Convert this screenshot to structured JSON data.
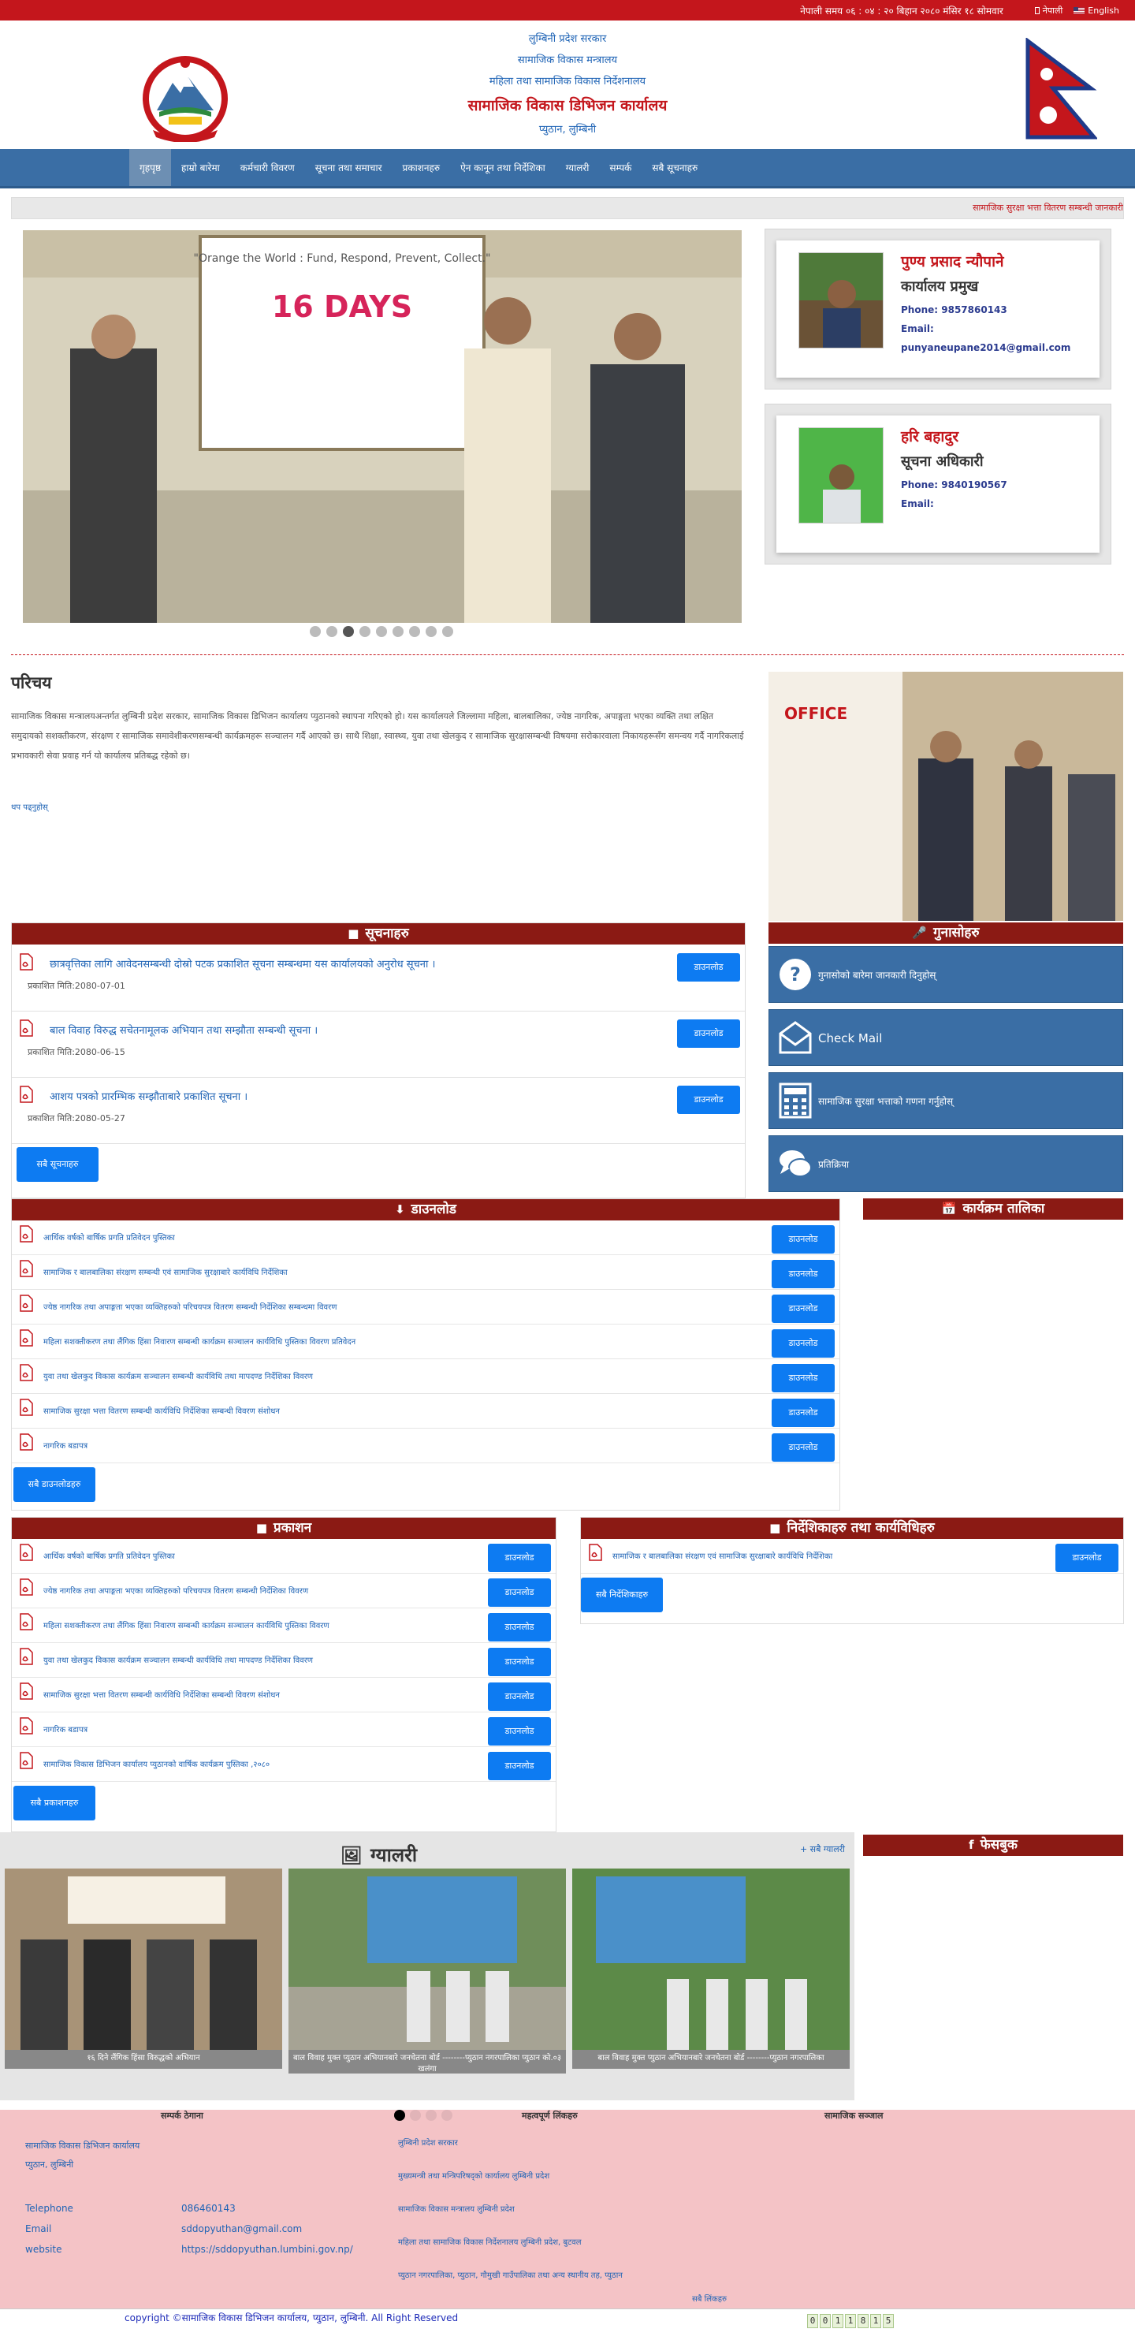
{
  "topbar": {
    "datetime": "नेपाली समय ०६ : ०४ : २० बिहान  २०८० मंसिर १८ सोमवार",
    "lang_np": "नेपाली",
    "lang_en": "English"
  },
  "header": {
    "line1": "लुम्बिनी प्रदेश सरकार",
    "line2": "सामाजिक विकास मन्त्रालय",
    "line3": "महिला तथा सामाजिक विकास निर्देशनालय",
    "office": "सामाजिक विकास डिभिजन कार्यालय",
    "location": "प्युठान, लुम्बिनी"
  },
  "nav": [
    "गृहपृष्ठ",
    "हाम्रो बारेमा",
    "कर्मचारी विवरण",
    "सूचना तथा समाचार",
    "प्रकाशनहरु",
    "ऐन कानून तथा निर्देशिका",
    "ग्यालरी",
    "सम्पर्क",
    "सबै सूचनाहरु"
  ],
  "ticker": "सामाजिक सुरक्षा भत्ता वितरण सम्बन्धी जानकारी",
  "officials": [
    {
      "name": "पुण्य प्रसाद न्यौपाने",
      "post": "कार्यालय प्रमुख",
      "phone": "Phone: 9857860143",
      "email": "Email: punyaneupane2014@gmail.com"
    },
    {
      "name": "हरि बहादुर",
      "post": "सूचना अधिकारी",
      "phone": "Phone: 9840190567",
      "email": "Email:"
    }
  ],
  "intro": {
    "title": "परिचय",
    "text": "सामाजिक विकास मन्त्रालयअन्तर्गत लुम्बिनी प्रदेश सरकार, सामाजिक विकास डिभिजन कार्यालय प्युठानको स्थापना गरिएको हो। यस कार्यालयले जिल्लामा महिला, बालबालिका, ज्येष्ठ नागरिक, अपाङ्गता भएका व्यक्ति तथा लक्षित समुदायको सशक्तीकरण, संरक्षण र सामाजिक समावेशीकरणसम्बन्धी कार्यक्रमहरू सञ्चालन गर्दै आएको छ। साथै शिक्षा, स्वास्थ्य, युवा तथा खेलकुद र सामाजिक सुरक्षासम्बन्धी विषयमा सरोकारवाला निकायहरूसँग समन्वय गर्दै नागरिकलाई प्रभावकारी सेवा प्रवाह गर्न यो कार्यालय प्रतिबद्ध रहेको छ।",
    "more": "थप पढ्नुहोस्"
  },
  "notices": {
    "title": "सूचनाहरु",
    "items": [
      {
        "title": "छात्रवृत्तिका लागि आवेदनसम्बन्धी दोस्रो पटक प्रकाशित सूचना सम्बन्धमा यस कार्यालयको अनुरोध सूचना ।",
        "date": "प्रकाशित मिति:2080-07-01",
        "btn": "डाउनलोड"
      },
      {
        "title": "बाल विवाह विरुद्ध सचेतनामूलक अभियान तथा सम्झौता सम्बन्धी सूचना ।",
        "date": "प्रकाशित मिति:2080-06-15",
        "btn": "डाउनलोड"
      },
      {
        "title": "आशय पत्रको प्रारम्भिक सम्झौताबारे प्रकाशित सूचना ।",
        "date": "प्रकाशित मिति:2080-05-27",
        "btn": "डाउनलोड"
      }
    ],
    "more": "सबै सूचनाहरु"
  },
  "grievance": {
    "title": "गुनासोहरु",
    "items": [
      "गुनासोको बारेमा जानकारी दिनुहोस्",
      "Check Mail",
      "सामाजिक सुरक्षा भत्ताको गणना गर्नुहोस्",
      "प्रतिक्रिया"
    ]
  },
  "downloads": {
    "title": "डाउनलोड",
    "items": [
      "आर्थिक वर्षको बार्षिक प्रगति प्रतिवेदन पुस्तिका",
      "सामाजिक र बालबालिका संरक्षण सम्बन्धी एवं सामाजिक सुरक्षाबारे कार्यविधि निर्देशिका",
      "ज्येष्ठ नागरिक तथा अपाङ्गता भएका व्यक्तिहरुको परिचयपत्र वितरण सम्बन्धी निर्देशिका सम्बन्धमा विवरण",
      "महिला सशक्तीकरण तथा लैंगिक हिंसा निवारण सम्बन्धी कार्यक्रम सञ्चालन कार्यविधि पुस्तिका विवरण प्रतिवेदन",
      "युवा तथा खेलकुद विकास कार्यक्रम सञ्चालन सम्बन्धी कार्यविधि तथा मापदण्ड निर्देशिका विवरण",
      "सामाजिक सुरक्षा भत्ता वितरण सम्बन्धी कार्यविधि निर्देशिका सम्बन्धी विवरण संशोधन",
      "नागरिक बडापत्र"
    ],
    "btn": "डाउनलोड",
    "more": "सबै डाउनलोडहरु"
  },
  "events": {
    "title": "कार्यक्रम तालिका"
  },
  "publications": {
    "title": "प्रकाशन",
    "items": [
      "आर्थिक वर्षको बार्षिक प्रगति प्रतिवेदन पुस्तिका",
      "ज्येष्ठ नागरिक तथा अपाङ्गता भएका व्यक्तिहरुको परिचयपत्र वितरण सम्बन्धी निर्देशिका विवरण",
      "महिला सशक्तीकरण तथा लैंगिक हिंसा निवारण सम्बन्धी कार्यक्रम सञ्चालन कार्यविधि पुस्तिका विवरण",
      "युवा तथा खेलकुद विकास कार्यक्रम सञ्चालन सम्बन्धी कार्यविधि तथा मापदण्ड निर्देशिका विवरण",
      "सामाजिक सुरक्षा भत्ता वितरण सम्बन्धी कार्यविधि निर्देशिका सम्बन्धी विवरण संशोधन",
      "नागरिक बडापत्र",
      "सामाजिक विकास डिभिजन कार्यालय प्युठानको वार्षिक कार्यक्रम पुस्तिका ,२०८०"
    ],
    "btn": "डाउनलोड",
    "more": "सबै प्रकाशनहरु"
  },
  "laws": {
    "title": "निर्देशिकाहरु तथा कार्यविधिहरु",
    "items": [
      "सामाजिक र बालबालिका संरक्षण एवं सामाजिक सुरक्षाबारे कार्यविधि निर्देशिका"
    ],
    "btn": "डाउनलोड",
    "more": "सबै निर्देशिकाहरु"
  },
  "gallery": {
    "title": "ग्यालरी",
    "more": "सबै ग्यालरी",
    "captions": [
      "१६ दिने लैंगिक हिंसा विरुद्धको अभियान",
      "बाल विवाह मुक्त प्युठान अभियानबारे जनचेतना बोर्ड --------प्युठान नगरपालिका प्युठान को.०३ खलंगा",
      "बाल विवाह मुक्त प्युठान अभियानबारे जनचेतना बोर्ड --------प्युठान नगरपालिका"
    ]
  },
  "facebook": {
    "title": "फेसबुक"
  },
  "footer": {
    "h_contact": "सम्पर्क ठेगाना",
    "h_links": "महत्वपूर्ण लिंकहरु",
    "h_social": "सामाजिक सञ्जाल",
    "org": "सामाजिक विकास डिभिजन कार्यालय",
    "addr": "प्युठान, लुम्बिनी",
    "telephone_label": "Telephone",
    "telephone": "086460143",
    "email_label": "Email",
    "email": "sddopyuthan@gmail.com",
    "website_label": "website",
    "website": "https://sddopyuthan.lumbini.gov.np/",
    "links": [
      "लुम्बिनी प्रदेश सरकार",
      "मुख्यमन्त्री तथा मन्त्रिपरिषद्को कार्यालय लुम्बिनी प्रदेश",
      "सामाजिक विकास मन्त्रालय लुम्बिनी प्रदेश",
      "महिला तथा सामाजिक विकास निर्देशनालय लुम्बिनी प्रदेश, बुटवल",
      "प्युठान नगरपालिका, प्युठान, गौमुखी गाउँपालिका तथा अन्य स्थानीय तह, प्युठान"
    ],
    "links_more": "सबै लिंकहरु",
    "copyright": "copyright ©सामाजिक विकास डिभिजन कार्यालय, प्युठान, लुम्बिनी. All Right Reserved",
    "counter": [
      "0",
      "0",
      "1",
      "1",
      "8",
      "1",
      "5"
    ]
  },
  "colors": {
    "brand_red": "#c4161c",
    "nav_blue": "#3a6ea5",
    "panel_header": "#8b1a14",
    "button_blue": "#0d7bf2",
    "footer_bg": "#f4c3c6"
  }
}
